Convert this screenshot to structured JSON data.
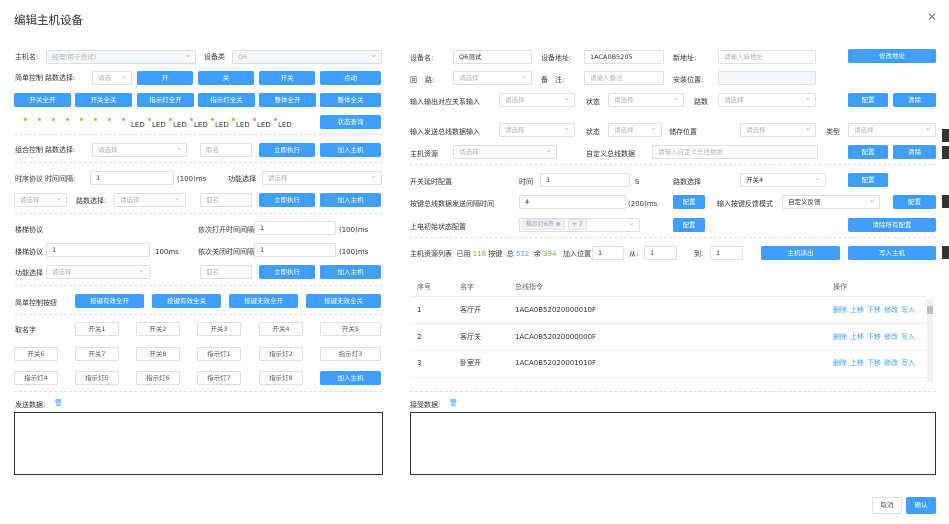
{
  "dialog": {
    "title": "编辑主机设备",
    "cancel": "取消",
    "confirm": "确认"
  },
  "left": {
    "host_name_label": "主机名:",
    "host_name_value": "经理(用于测试)",
    "device_type_label": "设备类",
    "device_type_value": "Q6",
    "simple_label": "简单控制",
    "route_label": "路数选择:",
    "route_ph": "请选",
    "b_on": "开",
    "b_off": "关",
    "b_toggle": "开关",
    "b_jog": "点动",
    "row2": [
      "开关全开",
      "开关全关",
      "指示灯全开",
      "指示灯全关",
      "整体全开",
      "整体全关"
    ],
    "led": "LED",
    "status_query": "状态查询",
    "combo_label": "组合控制",
    "combo_route": "路数选择:",
    "combo_sel_ph": "请选择",
    "name_ph": "取名",
    "run": "立即执行",
    "add_host": "加入主机",
    "timing_label": "时序协议",
    "time_interval_label": "时间间隔:",
    "time_interval_value": "1",
    "unit_100ms": "(100)ms",
    "func_select_label": "功能选择",
    "func_ph": "请选择",
    "timing_sel_ph": "请选择",
    "timing_route": "路数选择:",
    "timing_route_ph": "请选择",
    "stair_label": "楼梯协议",
    "open_interval_label": "依次打开时间间隔",
    "open_interval_value": "1",
    "stair2_label": "楼梯协议",
    "stair2_value": "1",
    "ms": "100ms",
    "close_interval_label": "依次关闭时间间隔",
    "close_interval_value": "1",
    "stair_func_label": "功能选择",
    "stair_func_ph": "请选择",
    "simple_btn_label": "简单控制按钮",
    "key_btns": [
      "按键有效全开",
      "按键有效全关",
      "按键无效全开",
      "按键无效全关"
    ],
    "naming_label": "取名字",
    "names": [
      "开关1",
      "开关2",
      "开关3",
      "开关4",
      "开关5",
      "开关6",
      "开关7",
      "开关8",
      "指示灯1",
      "指示灯2",
      "指示灯3",
      "指示灯4",
      "指示灯5",
      "指示灯6",
      "指示灯7",
      "指示灯8"
    ],
    "send_label": "发送数据:"
  },
  "right": {
    "dev_name_label": "设备名:",
    "dev_name_value": "Q6测试",
    "dev_addr_label": "设备地址:",
    "dev_addr_value": "1ACA0B5205",
    "new_addr_label": "新地址:",
    "new_addr_ph": "请输入新地址",
    "modify_addr": "修改地址",
    "loop_label": "回",
    "loop_label2": "路:",
    "loop_ph": "请选择",
    "remark_label": "备",
    "remark_label2": "注:",
    "remark_ph": "请输入备注",
    "install_label": "安装位置:",
    "io_label": "输入输出对应关系",
    "input_label": "输入",
    "io_ph": "请选择",
    "state_label": "状态",
    "state_ph": "请选择",
    "routes_label": "路数",
    "routes_ph": "请选择",
    "config": "配置",
    "clear": "清除",
    "send_bus_label": "输入发送总线数据",
    "input2": "输入",
    "input2_ph": "请选择",
    "state2": "状态",
    "state2_ph": "请选择",
    "store_label": "储存位置",
    "store_ph": "请选择",
    "type_label": "类型",
    "type_ph": "请选择",
    "host_res_label": "主机资源",
    "host_res_ph": "请选择",
    "custom_bus_label": "自定义总线数据",
    "custom_bus_ph": "请输入自定义总线数据",
    "delay_label": "开关延时配置",
    "time_label": "时间",
    "time_value": "1",
    "s": "S",
    "route_sel_label": "路数选择",
    "route_sel_value": "开关4",
    "key_bus_label": "按键总线数据发送间隔时间",
    "key_bus_value": "4",
    "unit_200ms": "(200)ms",
    "feedback_label": "输入按键反馈模式",
    "feedback_value": "自定义反馈",
    "power_label": "上电初始状态配置",
    "power_tag": "指示灯6开",
    "power_more": "+ 7",
    "clear_all": "清除所有配置",
    "list_label": "主机资源列表",
    "used_label": "已用",
    "used": "118",
    "key_label": "按键",
    "total_label": "总",
    "total": "512",
    "rest_label": "余",
    "rest": "394",
    "add_pos_label": "加入位置",
    "add_pos_value": "1",
    "from_label": "从:",
    "from_value": "1",
    "to_label": "到:",
    "to_value": "1",
    "read_host": "主机读出",
    "write_host": "写入主机",
    "cols": [
      "序号",
      "名字",
      "总线指令",
      "操作"
    ],
    "rows": [
      {
        "no": "1",
        "name": "客厅开",
        "cmd": "1ACA0B52020000010F"
      },
      {
        "no": "2",
        "name": "客厅关",
        "cmd": "1ACA0B52020000000F"
      },
      {
        "no": "3",
        "name": "卧室开",
        "cmd": "1ACA0B52020001010F"
      }
    ],
    "ops": [
      "删除",
      "上移",
      "下移",
      "修改",
      "写入"
    ],
    "recv_label": "接受数据:"
  }
}
